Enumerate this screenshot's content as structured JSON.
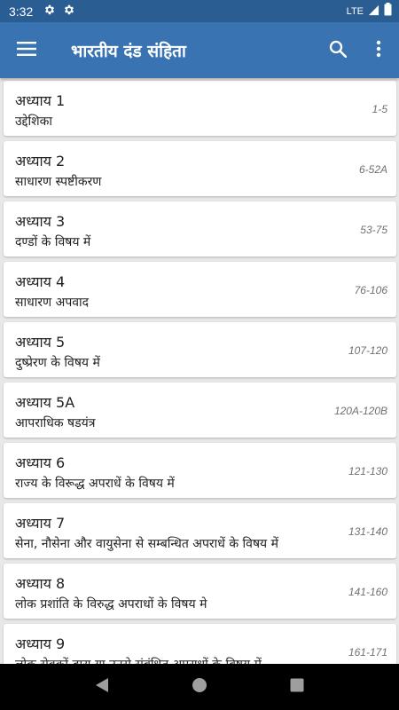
{
  "status_bar": {
    "time": "3:32",
    "network": "LTE",
    "icons": [
      "settings-icon",
      "settings-icon",
      "signal-icon",
      "battery-icon"
    ]
  },
  "app_bar": {
    "title": "भारतीय दंड संहिता",
    "icons": [
      "menu-icon",
      "search-icon",
      "more-vert-icon"
    ]
  },
  "chapters": [
    {
      "chapter": "अध्याय 1",
      "title": "उद्देशिका",
      "range": "1-5"
    },
    {
      "chapter": "अध्याय 2",
      "title": "साधारण स्पष्टीकरण",
      "range": "6-52A"
    },
    {
      "chapter": "अध्याय 3",
      "title": "दण्डों के विषय में",
      "range": "53-75"
    },
    {
      "chapter": "अध्याय 4",
      "title": "साधारण अपवाद",
      "range": "76-106"
    },
    {
      "chapter": "अध्याय 5",
      "title": "दुष्प्रेरण के विषय में",
      "range": "107-120"
    },
    {
      "chapter": "अध्याय 5A",
      "title": "आपराधिक षडयंत्र",
      "range": "120A-120B"
    },
    {
      "chapter": "अध्याय 6",
      "title": "राज्य के विरूद्ध अपराधें के विषय में",
      "range": "121-130"
    },
    {
      "chapter": "अध्याय 7",
      "title": "सेना, नौसेना और वायुसेना से सम्बन्धित अपराधें के विषय में",
      "range": "131-140"
    },
    {
      "chapter": "अध्याय 8",
      "title": "लोक प्रशांति के विरुद्ध अपराधों के विषय मे",
      "range": "141-160"
    },
    {
      "chapter": "अध्याय 9",
      "title": "लोक सेवकों द्वारा या उनसे संबंधित अपराधों के विषय में",
      "range": "161-171"
    }
  ],
  "nav_bar": {
    "icons": [
      "back-icon",
      "home-icon",
      "recents-icon"
    ]
  }
}
